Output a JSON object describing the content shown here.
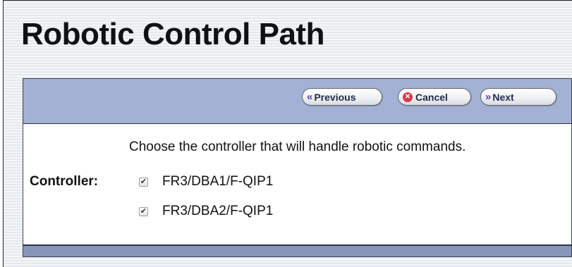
{
  "page": {
    "title": "Robotic Control Path"
  },
  "toolbar": {
    "previous_label": "Previous",
    "cancel_label": "Cancel",
    "next_label": "Next",
    "previous_icon": "«",
    "cancel_icon": "⊗",
    "next_icon": "»"
  },
  "form": {
    "instruction": "Choose the controller that will handle robotic commands.",
    "controller_label": "Controller:",
    "controllers": [
      {
        "name": "FR3/DBA1/F-QIP1",
        "checked": true
      },
      {
        "name": "FR3/DBA2/F-QIP1",
        "checked": true
      }
    ],
    "check_mark": "✔"
  },
  "colors": {
    "toolbar_bg": "#a2b1d4",
    "footer_bg": "#8795b8",
    "accent_purple": "#5b3fa8",
    "cancel_red": "#d8384a"
  }
}
